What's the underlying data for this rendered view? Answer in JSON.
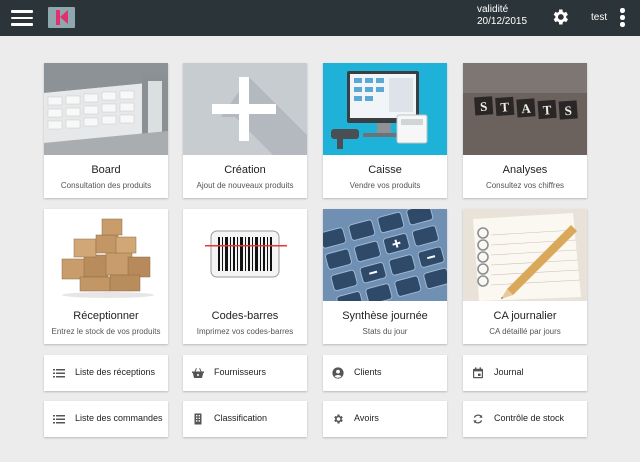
{
  "header": {
    "validity_label": "validité",
    "validity_date": "20/12/2015",
    "user": "test"
  },
  "tiles": [
    {
      "title": "Board",
      "subtitle": "Consultation des produits"
    },
    {
      "title": "Création",
      "subtitle": "Ajout de nouveaux produits"
    },
    {
      "title": "Caisse",
      "subtitle": "Vendre vos produits"
    },
    {
      "title": "Analyses",
      "subtitle": "Consultez vos chiffres"
    },
    {
      "title": "Réceptionner",
      "subtitle": "Entrez le stock de vos produits"
    },
    {
      "title": "Codes-barres",
      "subtitle": "Imprimez vos codes-barres"
    },
    {
      "title": "Synthèse journée",
      "subtitle": "Stats du jour"
    },
    {
      "title": "CA journalier",
      "subtitle": "CA détaillé par jours"
    }
  ],
  "stats_letters": [
    "S",
    "T",
    "A",
    "T",
    "S"
  ],
  "links": [
    {
      "label": "Liste des réceptions",
      "icon": "list-icon"
    },
    {
      "label": "Fournisseurs",
      "icon": "basket-icon"
    },
    {
      "label": "Clients",
      "icon": "account-icon"
    },
    {
      "label": "Journal",
      "icon": "calendar-icon"
    },
    {
      "label": "Liste des commandes",
      "icon": "list-icon"
    },
    {
      "label": "Classification",
      "icon": "building-icon"
    },
    {
      "label": "Avoirs",
      "icon": "gear-icon"
    },
    {
      "label": "Contrôle de stock",
      "icon": "sync-icon"
    }
  ],
  "colors": {
    "topbar": "#2b3539",
    "background": "#ececec",
    "logo_accent": "#e0306d",
    "caisse_bg": "#1fb2d8"
  }
}
